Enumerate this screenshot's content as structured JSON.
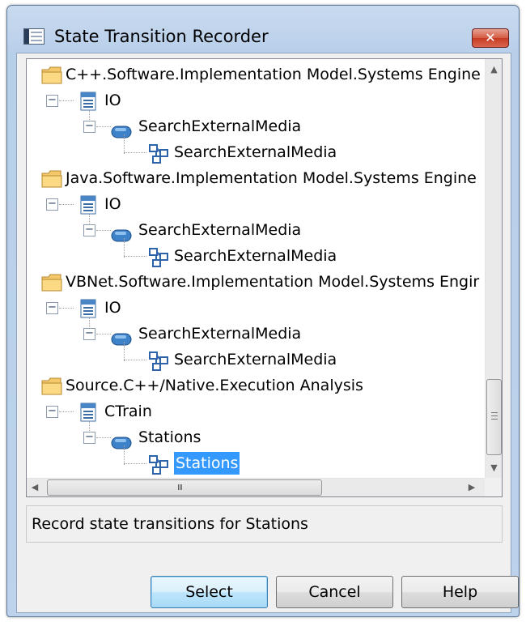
{
  "window": {
    "title": "State Transition Recorder",
    "close_label": "✕"
  },
  "tree": {
    "groups": [
      {
        "folder": "C++.Software.Implementation Model.Systems Engine",
        "class": "IO",
        "state": "SearchExternalMedia",
        "diagram": "SearchExternalMedia",
        "selected": false
      },
      {
        "folder": "Java.Software.Implementation Model.Systems Engine",
        "class": "IO",
        "state": "SearchExternalMedia",
        "diagram": "SearchExternalMedia",
        "selected": false
      },
      {
        "folder": "VBNet.Software.Implementation Model.Systems Engir",
        "class": "IO",
        "state": "SearchExternalMedia",
        "diagram": "SearchExternalMedia",
        "selected": false
      },
      {
        "folder": "Source.C++/Native.Execution Analysis",
        "class": "CTrain",
        "state": "Stations",
        "diagram": "Stations",
        "selected": true
      }
    ],
    "expander_symbol": "−",
    "hscroll_grip": "III"
  },
  "status": {
    "text": "Record state transitions for Stations"
  },
  "buttons": {
    "select": "Select",
    "cancel": "Cancel",
    "help": "Help"
  },
  "colors": {
    "selection": "#3399ff",
    "title_bar": "#c9daef",
    "close_button": "#c73b24"
  }
}
